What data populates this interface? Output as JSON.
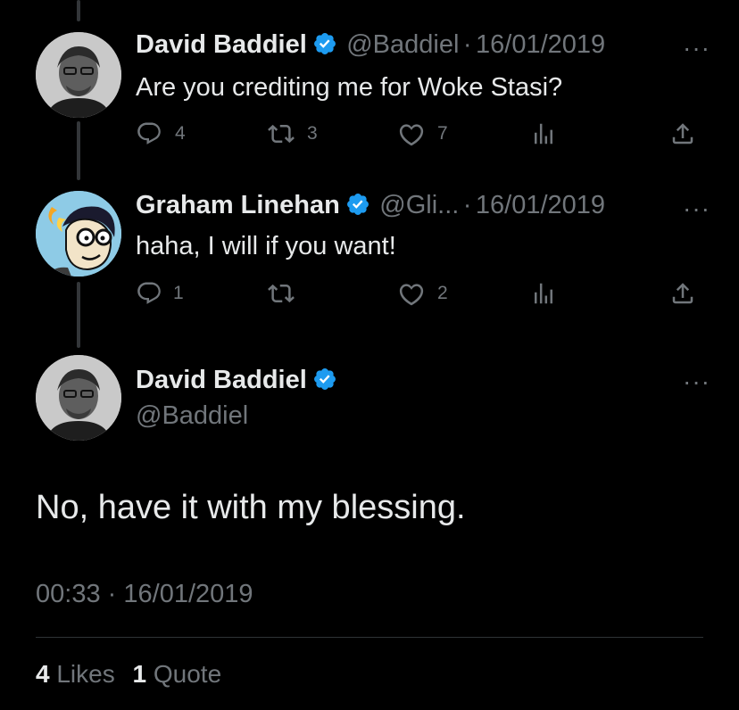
{
  "tweets": [
    {
      "name": "David Baddiel",
      "handle": "@Baddiel",
      "separator": "·",
      "date": "16/01/2019",
      "text": "Are you crediting me for Woke Stasi?",
      "replies": "4",
      "retweets": "3",
      "likes": "7"
    },
    {
      "name": "Graham Linehan",
      "handle": "@Gli...",
      "separator": "·",
      "date": "16/01/2019",
      "text": "haha, I will if you want!",
      "replies": "1",
      "retweets": "",
      "likes": "2"
    }
  ],
  "main": {
    "name": "David Baddiel",
    "handle": "@Baddiel",
    "text": "No, have it with my blessing.",
    "time": "00:33",
    "separator": "·",
    "date": "16/01/2019",
    "likes_count": "4",
    "likes_label": "Likes",
    "quotes_count": "1",
    "quotes_label": "Quote"
  },
  "more_label": "···",
  "colors": {
    "background": "#000000",
    "text": "#e7e9ea",
    "muted": "#71767b",
    "verified": "#1d9bf0",
    "divider": "#2f3336"
  },
  "icons": [
    "reply-icon",
    "retweet-icon",
    "like-icon",
    "analytics-icon",
    "share-icon",
    "verified-icon",
    "more-icon"
  ]
}
